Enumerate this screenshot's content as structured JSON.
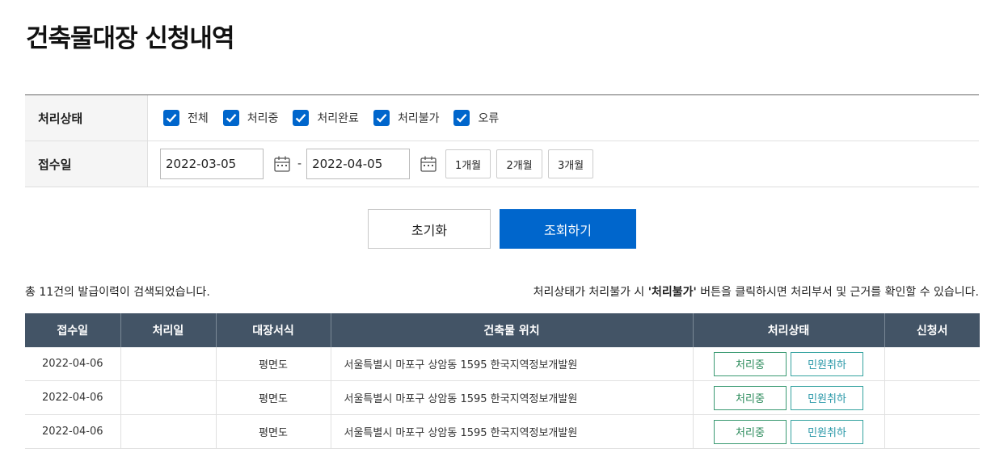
{
  "title": "건축물대장 신청내역",
  "filter": {
    "status_label": "처리상태",
    "status_options": [
      {
        "label": "전체",
        "checked": true
      },
      {
        "label": "처리중",
        "checked": true
      },
      {
        "label": "처리완료",
        "checked": true
      },
      {
        "label": "처리불가",
        "checked": true
      },
      {
        "label": "오류",
        "checked": true
      }
    ],
    "date_label": "접수일",
    "date_from": "2022-03-05",
    "date_separator": "-",
    "date_to": "2022-04-05",
    "periods": [
      "1개월",
      "2개월",
      "3개월"
    ]
  },
  "actions": {
    "reset": "초기화",
    "search": "조회하기"
  },
  "summary": {
    "count_text": "총 11건의 발급이력이 검색되었습니다.",
    "notice_prefix": "처리상태가 처리불가 시 ",
    "notice_bold": "'처리불가'",
    "notice_suffix": " 버튼을 클릭하시면 처리부서 및 근거를 확인할 수 있습니다."
  },
  "table": {
    "headers": [
      "접수일",
      "처리일",
      "대장서식",
      "건축물 위치",
      "처리상태",
      "신청서"
    ],
    "rows": [
      {
        "received": "2022-04-06",
        "processed": "",
        "form": "평면도",
        "location": "서울특별시 마포구 상암동 1595 한국지역정보개발원",
        "status": "처리중",
        "cancel": "민원취하",
        "application": ""
      },
      {
        "received": "2022-04-06",
        "processed": "",
        "form": "평면도",
        "location": "서울특별시 마포구 상암동 1595 한국지역정보개발원",
        "status": "처리중",
        "cancel": "민원취하",
        "application": ""
      },
      {
        "received": "2022-04-06",
        "processed": "",
        "form": "평면도",
        "location": "서울특별시 마포구 상암동 1595 한국지역정보개발원",
        "status": "처리중",
        "cancel": "민원취하",
        "application": ""
      }
    ]
  },
  "colors": {
    "primary": "#0066cc",
    "table_header": "#435466",
    "status_green": "#2a8a5a",
    "cancel_teal": "#2a98a8"
  },
  "icons": {
    "checkbox": "checkmark-icon",
    "calendar": "calendar-icon"
  }
}
